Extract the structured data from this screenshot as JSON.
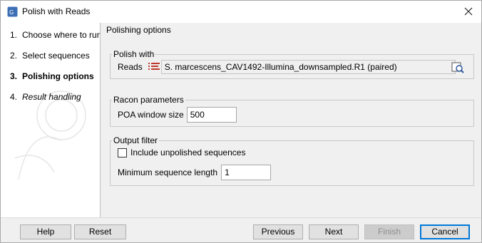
{
  "window": {
    "title": "Polish with Reads"
  },
  "steps": [
    {
      "num": "1.",
      "label": "Choose where to run"
    },
    {
      "num": "2.",
      "label": "Select sequences"
    },
    {
      "num": "3.",
      "label": "Polishing options"
    },
    {
      "num": "4.",
      "label": "Result handling"
    }
  ],
  "main": {
    "section_title": "Polishing options",
    "polish_with": {
      "legend": "Polish with",
      "reads_label": "Reads",
      "reads_value": "S. marcescens_CAV1492-Illumina_downsampled.R1 (paired)"
    },
    "racon": {
      "legend": "Racon parameters",
      "poa_label": "POA window size",
      "poa_value": "500"
    },
    "output_filter": {
      "legend": "Output filter",
      "include_unpolished_label": "Include unpolished sequences",
      "include_unpolished_checked": false,
      "min_length_label": "Minimum sequence length",
      "min_length_value": "1"
    }
  },
  "footer": {
    "help": "Help",
    "reset": "Reset",
    "previous": "Previous",
    "next": "Next",
    "finish": "Finish",
    "cancel": "Cancel"
  },
  "colors": {
    "accent": "#0078d7",
    "reads_icon": "#c0392b"
  }
}
